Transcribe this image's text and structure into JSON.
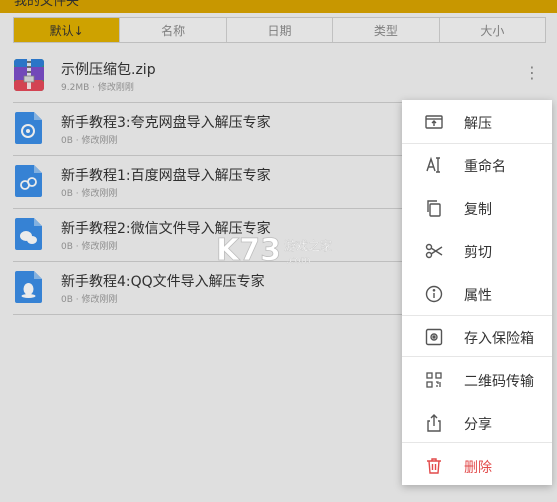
{
  "header": {
    "title": "我的文件夹"
  },
  "sort_tabs": [
    {
      "label": "默认↓",
      "active": true
    },
    {
      "label": "名称",
      "active": false
    },
    {
      "label": "日期",
      "active": false
    },
    {
      "label": "类型",
      "active": false
    },
    {
      "label": "大小",
      "active": false
    }
  ],
  "files": [
    {
      "name": "示例压缩包.zip",
      "meta": "9.2MB · 修改刚刚",
      "icon": "zip-archive-icon"
    },
    {
      "name": "新手教程3:夸克网盘导入解压专家",
      "meta": "0B · 修改刚刚",
      "icon": "quark-doc-icon"
    },
    {
      "name": "新手教程1:百度网盘导入解压专家",
      "meta": "0B · 修改刚刚",
      "icon": "baidu-doc-icon"
    },
    {
      "name": "新手教程2:微信文件导入解压专家",
      "meta": "0B · 修改刚刚",
      "icon": "wechat-doc-icon"
    },
    {
      "name": "新手教程4:QQ文件导入解压专家",
      "meta": "0B · 修改刚刚",
      "icon": "qq-doc-icon"
    }
  ],
  "menu": {
    "items": [
      {
        "label": "解压",
        "icon": "extract-icon"
      },
      {
        "label": "重命名",
        "icon": "rename-icon"
      },
      {
        "label": "复制",
        "icon": "copy-icon"
      },
      {
        "label": "剪切",
        "icon": "scissors-icon"
      },
      {
        "label": "属性",
        "icon": "info-icon"
      },
      {
        "label": "存入保险箱",
        "icon": "safe-icon"
      },
      {
        "label": "二维码传输",
        "icon": "qr-code-icon"
      },
      {
        "label": "分享",
        "icon": "share-icon"
      },
      {
        "label": "删除",
        "icon": "trash-icon"
      }
    ]
  },
  "watermark": {
    "brand": "K73",
    "tagline": "游戏之家",
    "domain": ".com"
  },
  "colors": {
    "accent": "#e0b000",
    "danger": "#e24a4a",
    "doc_blue": "#3b8ee6"
  }
}
